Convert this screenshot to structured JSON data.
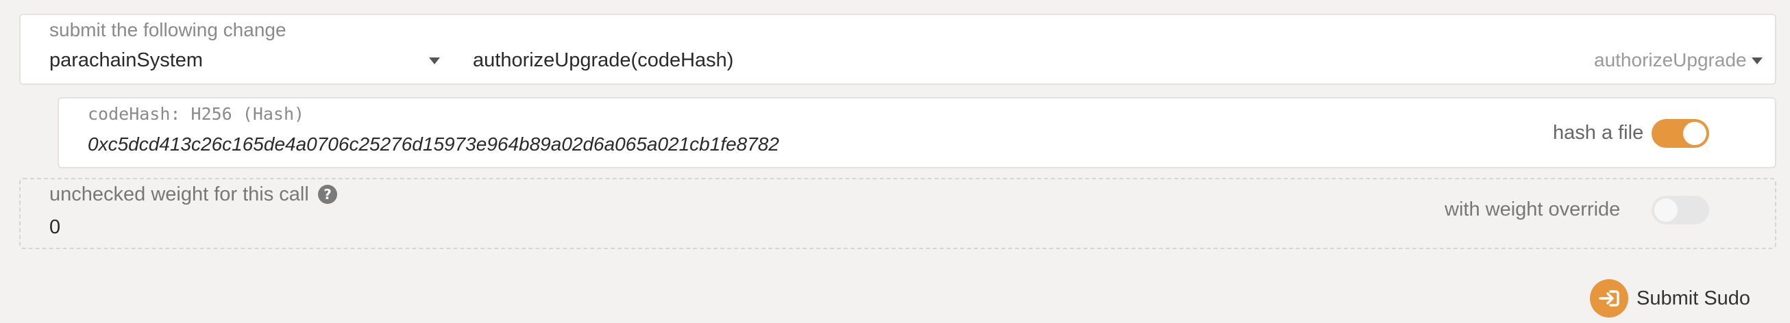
{
  "call_section": {
    "label": "submit the following change",
    "module": "parachainSystem",
    "method": "authorizeUpgrade(codeHash)",
    "method_short": "authorizeUpgrade"
  },
  "param": {
    "label": "codeHash: H256 (Hash)",
    "value": "0xc5dcd413c26c165de4a0706c25276d15973e964b89a02d6a065a021cb1fe8782",
    "toggle_label": "hash a file",
    "toggle_on": true
  },
  "weight": {
    "label": "unchecked weight for this call",
    "help_icon": "?",
    "value": "0",
    "toggle_label": "with weight override",
    "toggle_on": false
  },
  "submit": {
    "label": "Submit Sudo"
  },
  "colors": {
    "accent": "#e6963d",
    "background": "#f3f2f1"
  }
}
